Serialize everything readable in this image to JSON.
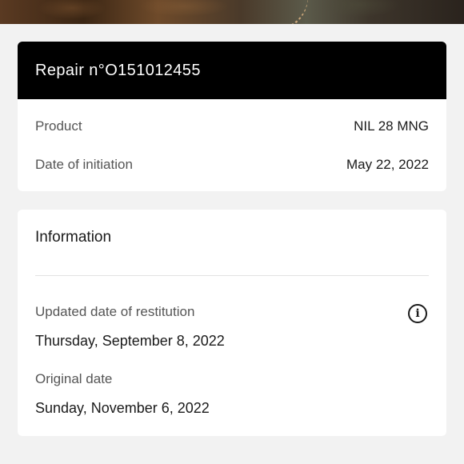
{
  "repair": {
    "title": "Repair n°O151012455",
    "product_label": "Product",
    "product_value": "NIL 28 MNG",
    "date_label": "Date of initiation",
    "date_value": "May 22, 2022"
  },
  "information": {
    "title": "Information",
    "updated_label": "Updated date of restitution",
    "updated_value": "Thursday, September 8, 2022",
    "original_label": "Original date",
    "original_value": "Sunday, November 6, 2022",
    "info_icon": "info-icon",
    "info_glyph": "i"
  },
  "colors": {
    "header_bg": "#000000",
    "page_bg": "#f2f2f2",
    "card_bg": "#ffffff"
  }
}
